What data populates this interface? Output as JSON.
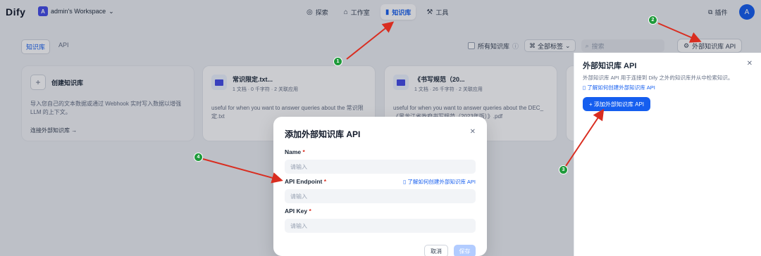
{
  "app": {
    "logo": "Dify",
    "workspace_initial": "A",
    "workspace": "admin's Workspace"
  },
  "nav": [
    {
      "icon": "explore-icon",
      "label": "探索"
    },
    {
      "icon": "studio-icon",
      "label": "工作室"
    },
    {
      "icon": "knowledge-icon",
      "label": "知识库",
      "active": true
    },
    {
      "icon": "tools-icon",
      "label": "工具"
    }
  ],
  "plugins_label": "插件",
  "avatar_initial": "A",
  "subtabs": [
    "知识库",
    "API"
  ],
  "filters": {
    "all_kb": "所有知识库",
    "all_tags": "全部标签",
    "search_placeholder": "搜索"
  },
  "ext_api_button": "外部知识库 API",
  "create_card": {
    "title": "创建知识库",
    "desc": "导入您自己的文本数据或通过 Webhook 实时写入数据以增强 LLM 的上下文。",
    "link": "连接外部知识库 →"
  },
  "kb_cards": [
    {
      "name": "常识限定.txt...",
      "meta": "1 文档 · 0 千字符 · 2 关联应用",
      "desc": "useful for when you want to answer queries about the 常识限定.txt"
    },
    {
      "name": "《书写规范（20...",
      "meta": "1 文档 · 26 千字符 · 2 关联应用",
      "desc": "useful for when you want to answer queries about the DEC_《黑龙江省政府书写规范（2023年版）》.pdf"
    }
  ],
  "panel": {
    "title": "外部知识库 API",
    "desc": "外部知识库 API 用于连接到 Dify 之外的知识库并从中检索知识。",
    "link": "了解如何创建外部知识库 API",
    "button": "+ 添加外部知识库 API"
  },
  "modal": {
    "title": "添加外部知识库 API",
    "fields": [
      {
        "label": "Name",
        "placeholder": "请输入"
      },
      {
        "label": "API Endpoint",
        "placeholder": "请输入",
        "help": "了解如何创建外部知识库 API"
      },
      {
        "label": "API Key",
        "placeholder": "请输入"
      }
    ],
    "cancel": "取消",
    "save": "保存"
  },
  "steps": [
    "1",
    "2",
    "3",
    "4"
  ],
  "colors": {
    "accent": "#155eef",
    "arrow": "#d92d20",
    "step_badge": "#1e9a3a"
  }
}
